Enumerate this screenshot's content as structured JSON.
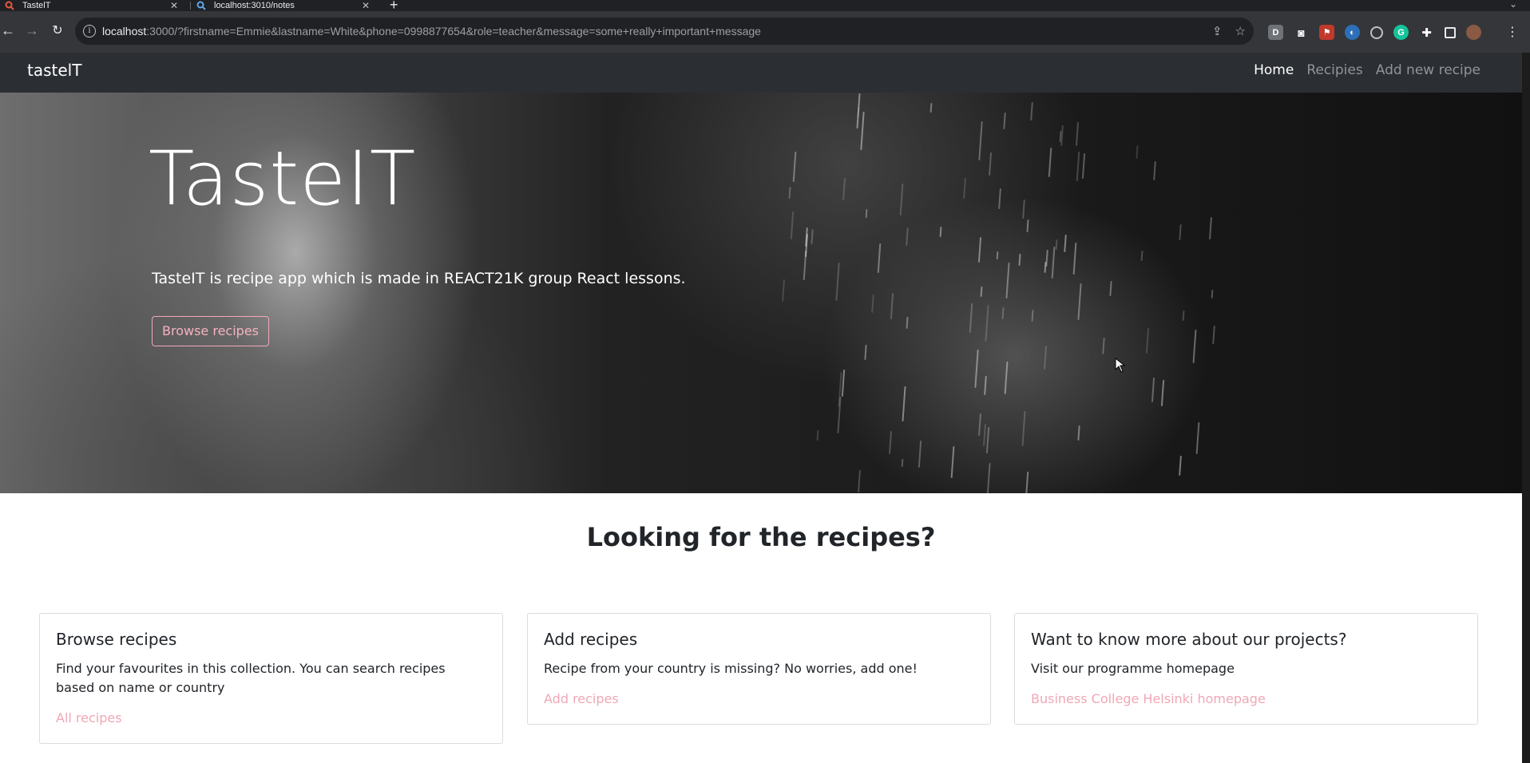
{
  "browser": {
    "tabs": [
      {
        "title": "TastelT",
        "icon": "magnifier-favicon-icon"
      },
      {
        "title": "localhost:3010/notes",
        "icon": "magnifier-favicon-icon"
      }
    ],
    "url": {
      "host": "localhost",
      "rest": ":3000/?firstname=Emmie&lastname=White&phone=0998877654&role=teacher&message=some+really+important+message"
    },
    "extension_letter": "D"
  },
  "navbar": {
    "brand": "tastelT",
    "links": [
      "Home",
      "Recipies",
      "Add new recipe"
    ],
    "active": "Home"
  },
  "hero": {
    "title": "TasteIT",
    "text": "TasteIT is recipe app which is made in REACT21K group React lessons.",
    "button": "Browse recipes"
  },
  "section": {
    "title": "Looking for the recipes?"
  },
  "cards": [
    {
      "title": "Browse recipes",
      "text": "Find your favourites in this collection. You can search recipes based on name or country",
      "link": "All recipes"
    },
    {
      "title": "Add recipes",
      "text": "Recipe from your country is missing? No worries, add one!",
      "link": "Add recipes"
    },
    {
      "title": "Want to know more about our projects?",
      "text": "Visit our programme homepage",
      "link": "Business College Helsinki homepage"
    }
  ],
  "colors": {
    "navbar_bg": "#2b2e33",
    "accent_pink": "#f0a7b6",
    "chrome_toolbar": "#35363a"
  }
}
